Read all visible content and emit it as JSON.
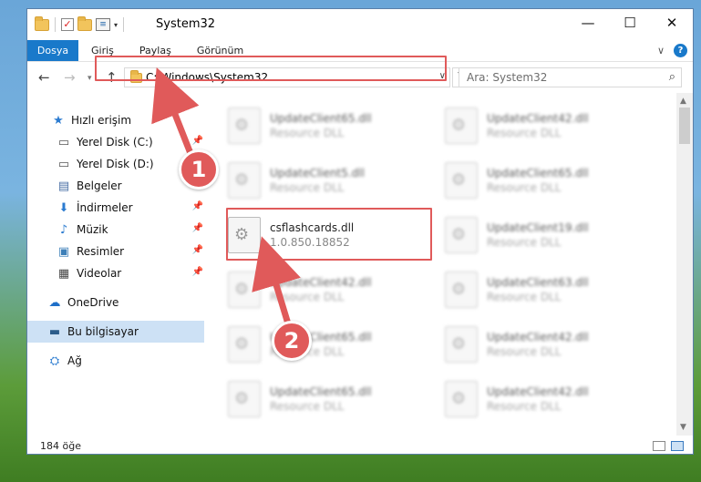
{
  "window": {
    "title": "System32",
    "min": "—",
    "max": "☐",
    "close": "✕"
  },
  "ribbon": {
    "tabs": [
      "Dosya",
      "Giriş",
      "Paylaş",
      "Görünüm"
    ]
  },
  "address": {
    "path": "C:\\Windows\\System32",
    "search_placeholder": "Ara: System32"
  },
  "nav": {
    "items": [
      {
        "label": "Hızlı erişim",
        "icon": "star-icon"
      },
      {
        "label": "Yerel Disk (C:)",
        "icon": "drive-icon",
        "pinned": true
      },
      {
        "label": "Yerel Disk (D:)",
        "icon": "drive-icon",
        "pinned": true
      },
      {
        "label": "Belgeler",
        "icon": "documents-icon",
        "pinned": true
      },
      {
        "label": "İndirmeler",
        "icon": "download-icon",
        "pinned": true
      },
      {
        "label": "Müzik",
        "icon": "music-icon",
        "pinned": true
      },
      {
        "label": "Resimler",
        "icon": "pictures-icon",
        "pinned": true
      },
      {
        "label": "Videolar",
        "icon": "videos-icon",
        "pinned": true
      },
      {
        "label": "OneDrive",
        "icon": "cloud-icon"
      },
      {
        "label": "Bu bilgisayar",
        "icon": "computer-icon",
        "selected": true
      },
      {
        "label": "Ağ",
        "icon": "network-icon"
      }
    ]
  },
  "files": {
    "left": [
      {
        "name": "UpdateClient65.dll",
        "type": "Resource DLL"
      },
      {
        "name": "UpdateClient5.dll",
        "type": "Resource DLL"
      },
      {
        "name": "csflashcards.dll",
        "type": "1.0.850.18852"
      },
      {
        "name": "UpdateClient42.dll",
        "type": "Resource DLL"
      },
      {
        "name": "UpdateClient65.dll",
        "type": "Resource DLL"
      },
      {
        "name": "UpdateClient65.dll",
        "type": "Resource DLL"
      }
    ],
    "right": [
      {
        "name": "UpdateClient42.dll",
        "type": "Resource DLL"
      },
      {
        "name": "UpdateClient65.dll",
        "type": "Resource DLL"
      },
      {
        "name": "UpdateClient19.dll",
        "type": "Resource DLL"
      },
      {
        "name": "UpdateClient63.dll",
        "type": "Resource DLL"
      },
      {
        "name": "UpdateClient42.dll",
        "type": "Resource DLL"
      },
      {
        "name": "UpdateClient42.dll",
        "type": "Resource DLL"
      }
    ]
  },
  "status": {
    "count": "184 öğe"
  },
  "annotations": {
    "badge1": "1",
    "badge2": "2",
    "color": "#e05a5a"
  }
}
